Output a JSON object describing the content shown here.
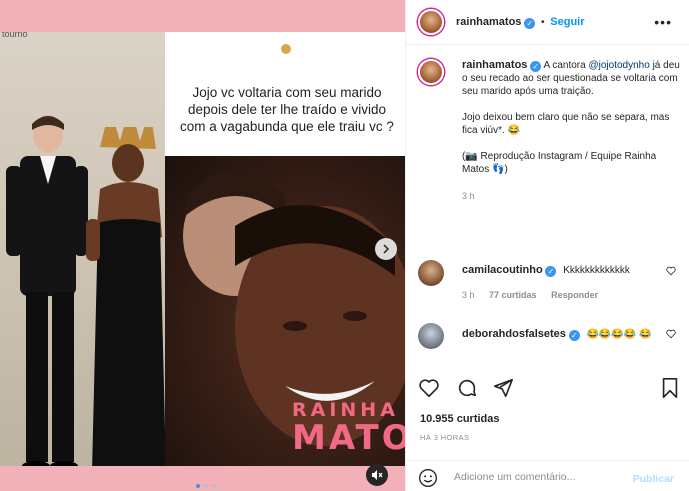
{
  "media": {
    "top_label": "tourno",
    "question": "Jojo vc voltaria com seu marido depois dele ter lhe traído e vivido com a vagabunda que ele traiu vc ?",
    "brand_line1": "RAINHA",
    "brand_line2": "MATOS",
    "carousel_total": 3,
    "carousel_active": 1
  },
  "header": {
    "username": "rainhamatos",
    "follow_label": "Seguir",
    "separator": "•"
  },
  "caption": {
    "username": "rainhamatos",
    "text_pre": "A cantora",
    "mention": "@jojotodynho",
    "text_post": "já deu o seu recado ao ser questionada se voltaria com seu marido após uma traição.",
    "paragraph2": "Jojo deixou bem claro que não se separa, mas fica viúv*. 😂",
    "paragraph3": "(📷 Reprodução Instagram / Equipe Rainha Matos 👣)",
    "time": "3 h"
  },
  "comments": [
    {
      "username": "camilacoutinho",
      "verified": true,
      "text": "Kkkkkkkkkkkkk",
      "time": "3 h",
      "likes": "77 curtidas",
      "reply_label": "Responder"
    },
    {
      "username": "deborahdosfalsetes",
      "verified": true,
      "text": "😂😂😂😂 😂",
      "time": "",
      "likes": "",
      "reply_label": ""
    }
  ],
  "stats": {
    "likes": "10.955 curtidas",
    "time_ago": "HÁ 3 HORAS"
  },
  "comment_box": {
    "placeholder": "Adicione um comentário...",
    "publish_label": "Publicar"
  },
  "colors": {
    "accent": "#0095f6",
    "verified": "#3897f0",
    "brand_pink": "#f06a86",
    "media_bg": "#f2b0b8"
  },
  "icons": [
    "heart-icon",
    "comment-icon",
    "share-icon",
    "save-icon",
    "emoji-icon",
    "more-icon",
    "mute-icon",
    "chevron-right-icon"
  ]
}
